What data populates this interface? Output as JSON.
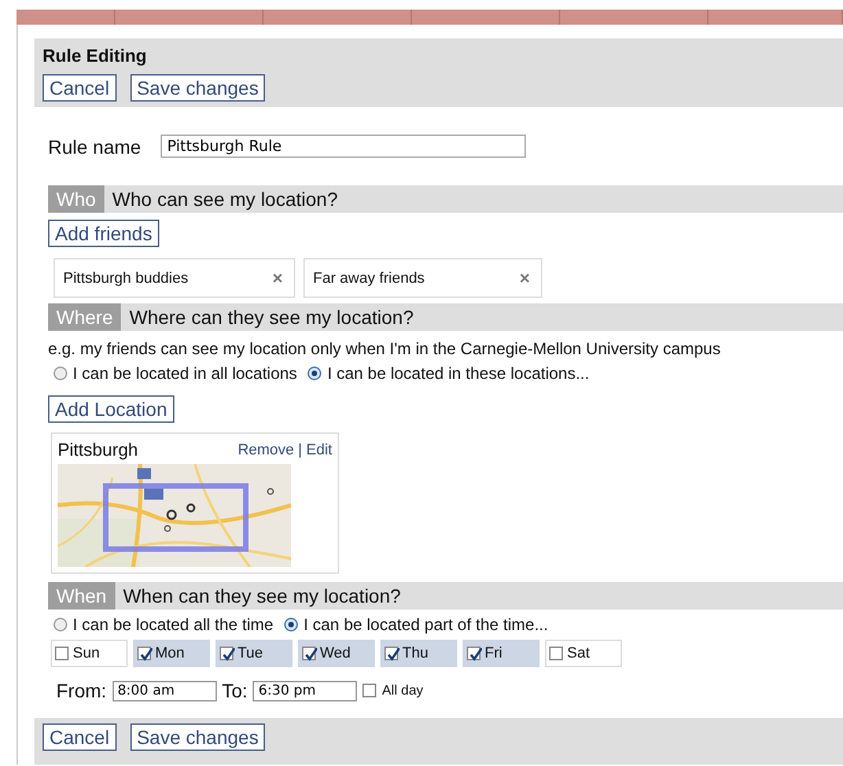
{
  "header": {
    "title": "Rule Editing",
    "buttons": [
      "Cancel",
      "Save changes"
    ]
  },
  "rule_name": {
    "label": "Rule name",
    "value": "Pittsburgh Rule"
  },
  "who": {
    "tag": "Who",
    "question": "Who can see my location?",
    "add_button": "Add friends",
    "groups": [
      {
        "name": "Pittsburgh buddies",
        "remove": "×"
      },
      {
        "name": "Far away friends",
        "remove": "×"
      }
    ]
  },
  "where": {
    "tag": "Where",
    "question": "Where can they see my location?",
    "example": "e.g. my friends can see my location only when I'm in the Carnegie-Mellon University campus",
    "options": [
      {
        "label": "I can be located in all locations",
        "selected": false
      },
      {
        "label": "I can be located in these locations...",
        "selected": true
      }
    ],
    "add_button": "Add Location",
    "locations": [
      {
        "name": "Pittsburgh",
        "remove": "Remove",
        "separator": "|",
        "edit": "Edit"
      }
    ]
  },
  "when": {
    "tag": "When",
    "question": "When can they see my location?",
    "options": [
      {
        "label": "I can be located all the time",
        "selected": false
      },
      {
        "label": "I can be located part of the time...",
        "selected": true
      }
    ],
    "days": [
      {
        "label": "Sun",
        "checked": false
      },
      {
        "label": "Mon",
        "checked": true
      },
      {
        "label": "Tue",
        "checked": true
      },
      {
        "label": "Wed",
        "checked": true
      },
      {
        "label": "Thu",
        "checked": true
      },
      {
        "label": "Fri",
        "checked": true
      },
      {
        "label": "Sat",
        "checked": false
      }
    ],
    "from_label": "From:",
    "from_value": "8:00 am",
    "to_label": "To:",
    "to_value": "6:30 pm",
    "all_day": {
      "label": "All day",
      "checked": false
    }
  },
  "footer": {
    "buttons": [
      "Cancel",
      "Save changes"
    ]
  }
}
